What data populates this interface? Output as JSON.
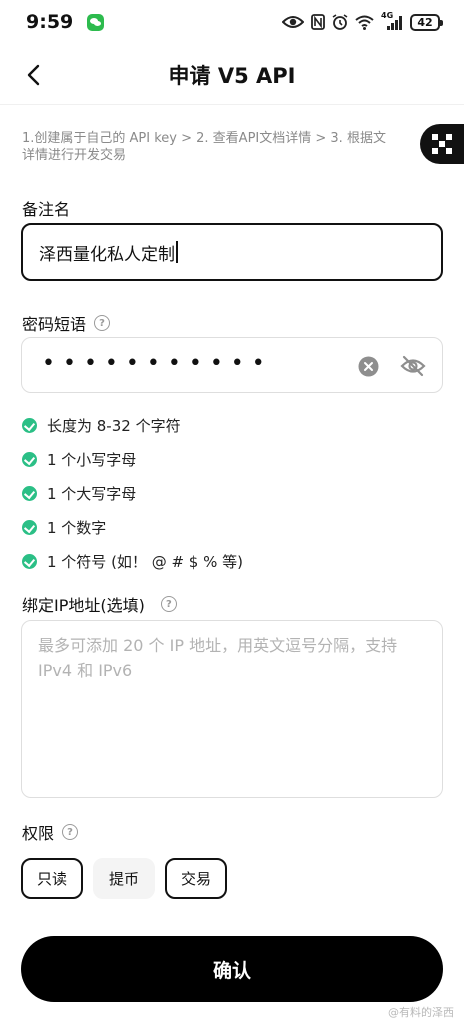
{
  "status_bar": {
    "time": "9:59",
    "network_type": "4G",
    "battery": "42"
  },
  "header": {
    "title": "申请 V5 API"
  },
  "steps": {
    "line1": "1.创建属于自己的 API key > 2. 查看API文档详情 > 3. 根据文",
    "line2": "详情进行开发交易"
  },
  "remark": {
    "label": "备注名",
    "value": "泽西量化私人定制"
  },
  "passphrase": {
    "label": "密码短语",
    "masked_value": "•••••••••••"
  },
  "rules": [
    {
      "text": "长度为 8-32 个字符",
      "status": "met"
    },
    {
      "text": "1 个小写字母",
      "status": "met"
    },
    {
      "text": "1 个大写字母",
      "status": "met"
    },
    {
      "text": "1 个数字",
      "status": "met"
    },
    {
      "text": "1 个符号 (如！ @ # $ % 等)",
      "status": "met"
    }
  ],
  "ip_binding": {
    "label": "绑定IP地址(选填)",
    "placeholder": "最多可添加 20 个 IP 地址，用英文逗号分隔，支持 IPv4 和 IPv6"
  },
  "permissions": {
    "label": "权限",
    "options": [
      {
        "label": "只读",
        "selected": true
      },
      {
        "label": "提币",
        "selected": false
      },
      {
        "label": "交易",
        "selected": true
      }
    ]
  },
  "confirm_label": "确认",
  "watermark": "@有料的泽西",
  "colors": {
    "check_green": "#2bbf86",
    "primary_black": "#000000",
    "placeholder_gray": "#b3b3b3",
    "muted_text": "#8a8a8a"
  }
}
